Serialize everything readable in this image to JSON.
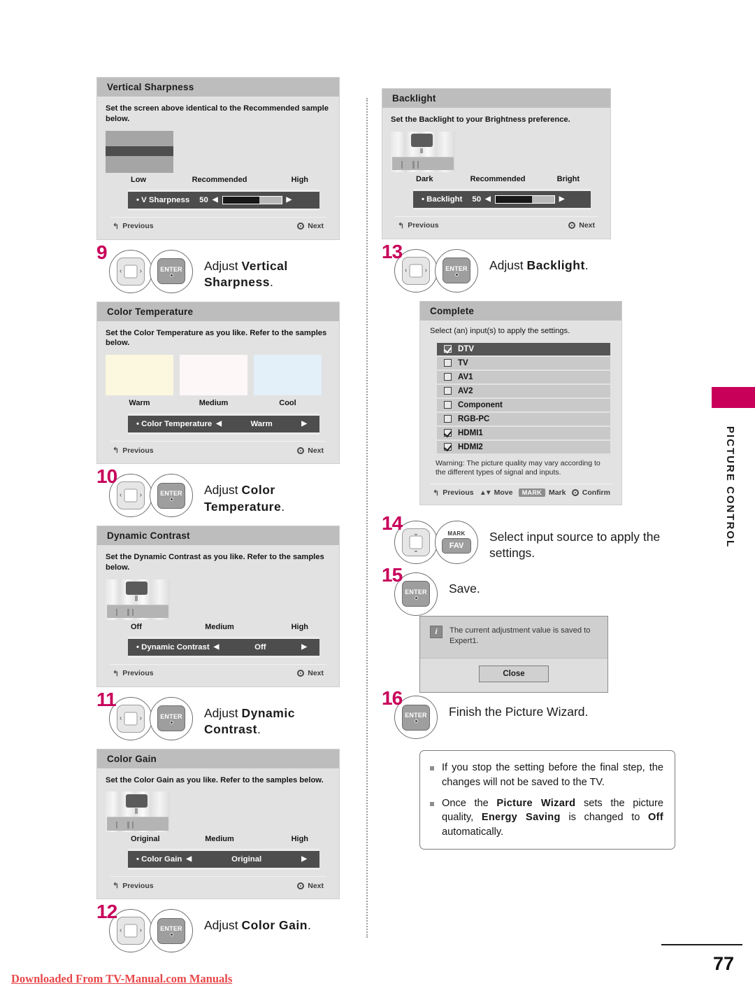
{
  "page": {
    "number": "77",
    "side_tab": "PICTURE CONTROL",
    "footer_link": "Downloaded From TV-Manual.com Manuals"
  },
  "panels": {
    "vertical_sharpness": {
      "title": "Vertical Sharpness",
      "description": "Set the screen above identical to the Recommended sample below.",
      "scale": {
        "low": "Low",
        "mid": "Recommended",
        "high": "High"
      },
      "slider": {
        "label": "• V Sharpness",
        "value": "50",
        "fill_percent": 62
      },
      "footer": {
        "previous": "Previous",
        "next": "Next"
      }
    },
    "color_temperature": {
      "title": "Color Temperature",
      "description": "Set the Color Temperature as you like. Refer to the samples below.",
      "swatches": [
        {
          "label": "Warm",
          "color": "#fcf8e0"
        },
        {
          "label": "Medium",
          "color": "#fdf7f7"
        },
        {
          "label": "Cool",
          "color": "#e3eff9"
        }
      ],
      "option": {
        "label": "• Color Temperature",
        "value": "Warm"
      },
      "footer": {
        "previous": "Previous",
        "next": "Next"
      }
    },
    "dynamic_contrast": {
      "title": "Dynamic Contrast",
      "description": "Set the Dynamic Contrast as you like. Refer to the samples below.",
      "scale": {
        "low": "Off",
        "mid": "Medium",
        "high": "High"
      },
      "option": {
        "label": "• Dynamic Contrast",
        "value": "Off"
      },
      "footer": {
        "previous": "Previous",
        "next": "Next"
      }
    },
    "color_gain": {
      "title": "Color Gain",
      "description": "Set the Color Gain as you like. Refer to the samples below.",
      "scale": {
        "low": "Original",
        "mid": "Medium",
        "high": "High"
      },
      "option": {
        "label": "• Color Gain",
        "value": "Original"
      },
      "footer": {
        "previous": "Previous",
        "next": "Next"
      }
    },
    "backlight": {
      "title": "Backlight",
      "description": "Set the Backlight to your Brightness preference.",
      "scale": {
        "low": "Dark",
        "mid": "Recommended",
        "high": "Bright"
      },
      "slider": {
        "label": "• Backlight",
        "value": "50",
        "fill_percent": 62
      },
      "footer": {
        "previous": "Previous",
        "next": "Next"
      }
    },
    "complete": {
      "title": "Complete",
      "description": "Select (an) input(s) to apply the settings.",
      "inputs": [
        {
          "label": "DTV",
          "checked": true,
          "highlighted": true
        },
        {
          "label": "TV",
          "checked": false,
          "highlighted": false
        },
        {
          "label": "AV1",
          "checked": false,
          "highlighted": false
        },
        {
          "label": "AV2",
          "checked": false,
          "highlighted": false
        },
        {
          "label": "Component",
          "checked": false,
          "highlighted": false
        },
        {
          "label": "RGB-PC",
          "checked": false,
          "highlighted": false
        },
        {
          "label": "HDMI1",
          "checked": true,
          "highlighted": false
        },
        {
          "label": "HDMI2",
          "checked": true,
          "highlighted": false
        }
      ],
      "warning": "Warning: The picture quality may vary according to the different types of signal and inputs.",
      "footer": {
        "previous": "Previous",
        "move": "Move",
        "mark_key": "MARK",
        "mark": "Mark",
        "confirm": "Confirm"
      }
    }
  },
  "steps": {
    "s9": {
      "num": "9",
      "text_plain": "Adjust ",
      "text_bold": "Vertical Sharpness",
      "text_tail": "."
    },
    "s10": {
      "num": "10",
      "text_plain": "Adjust ",
      "text_bold": "Color Temperature",
      "text_tail": "."
    },
    "s11": {
      "num": "11",
      "text_plain": "Adjust ",
      "text_bold": "Dynamic Contrast",
      "text_tail": "."
    },
    "s12": {
      "num": "12",
      "text_plain": "Adjust ",
      "text_bold": "Color Gain",
      "text_tail": "."
    },
    "s13": {
      "num": "13",
      "text_plain": "Adjust ",
      "text_bold": "Backlight",
      "text_tail": "."
    },
    "s14": {
      "num": "14",
      "text": "Select input source to apply the settings."
    },
    "s15": {
      "num": "15",
      "text": "Save."
    },
    "s16": {
      "num": "16",
      "text": "Finish the Picture Wizard."
    }
  },
  "keys": {
    "enter": "ENTER",
    "mark": "MARK",
    "fav": "FAV"
  },
  "save_dialog": {
    "message": "The current adjustment value is saved to Expert1.",
    "close": "Close"
  },
  "notes": [
    {
      "pre": "If you stop the setting before the final step, the changes will not be saved to the TV."
    },
    {
      "pre": "Once the ",
      "b1": "Picture Wizard",
      "mid1": " sets the picture quality, ",
      "b2": "Energy Saving",
      "mid2": " is changed to ",
      "b3": "Off",
      "tail": " automatically."
    }
  ],
  "colors": {
    "accent": "#c8005a",
    "footer_link": "#e8474a"
  }
}
